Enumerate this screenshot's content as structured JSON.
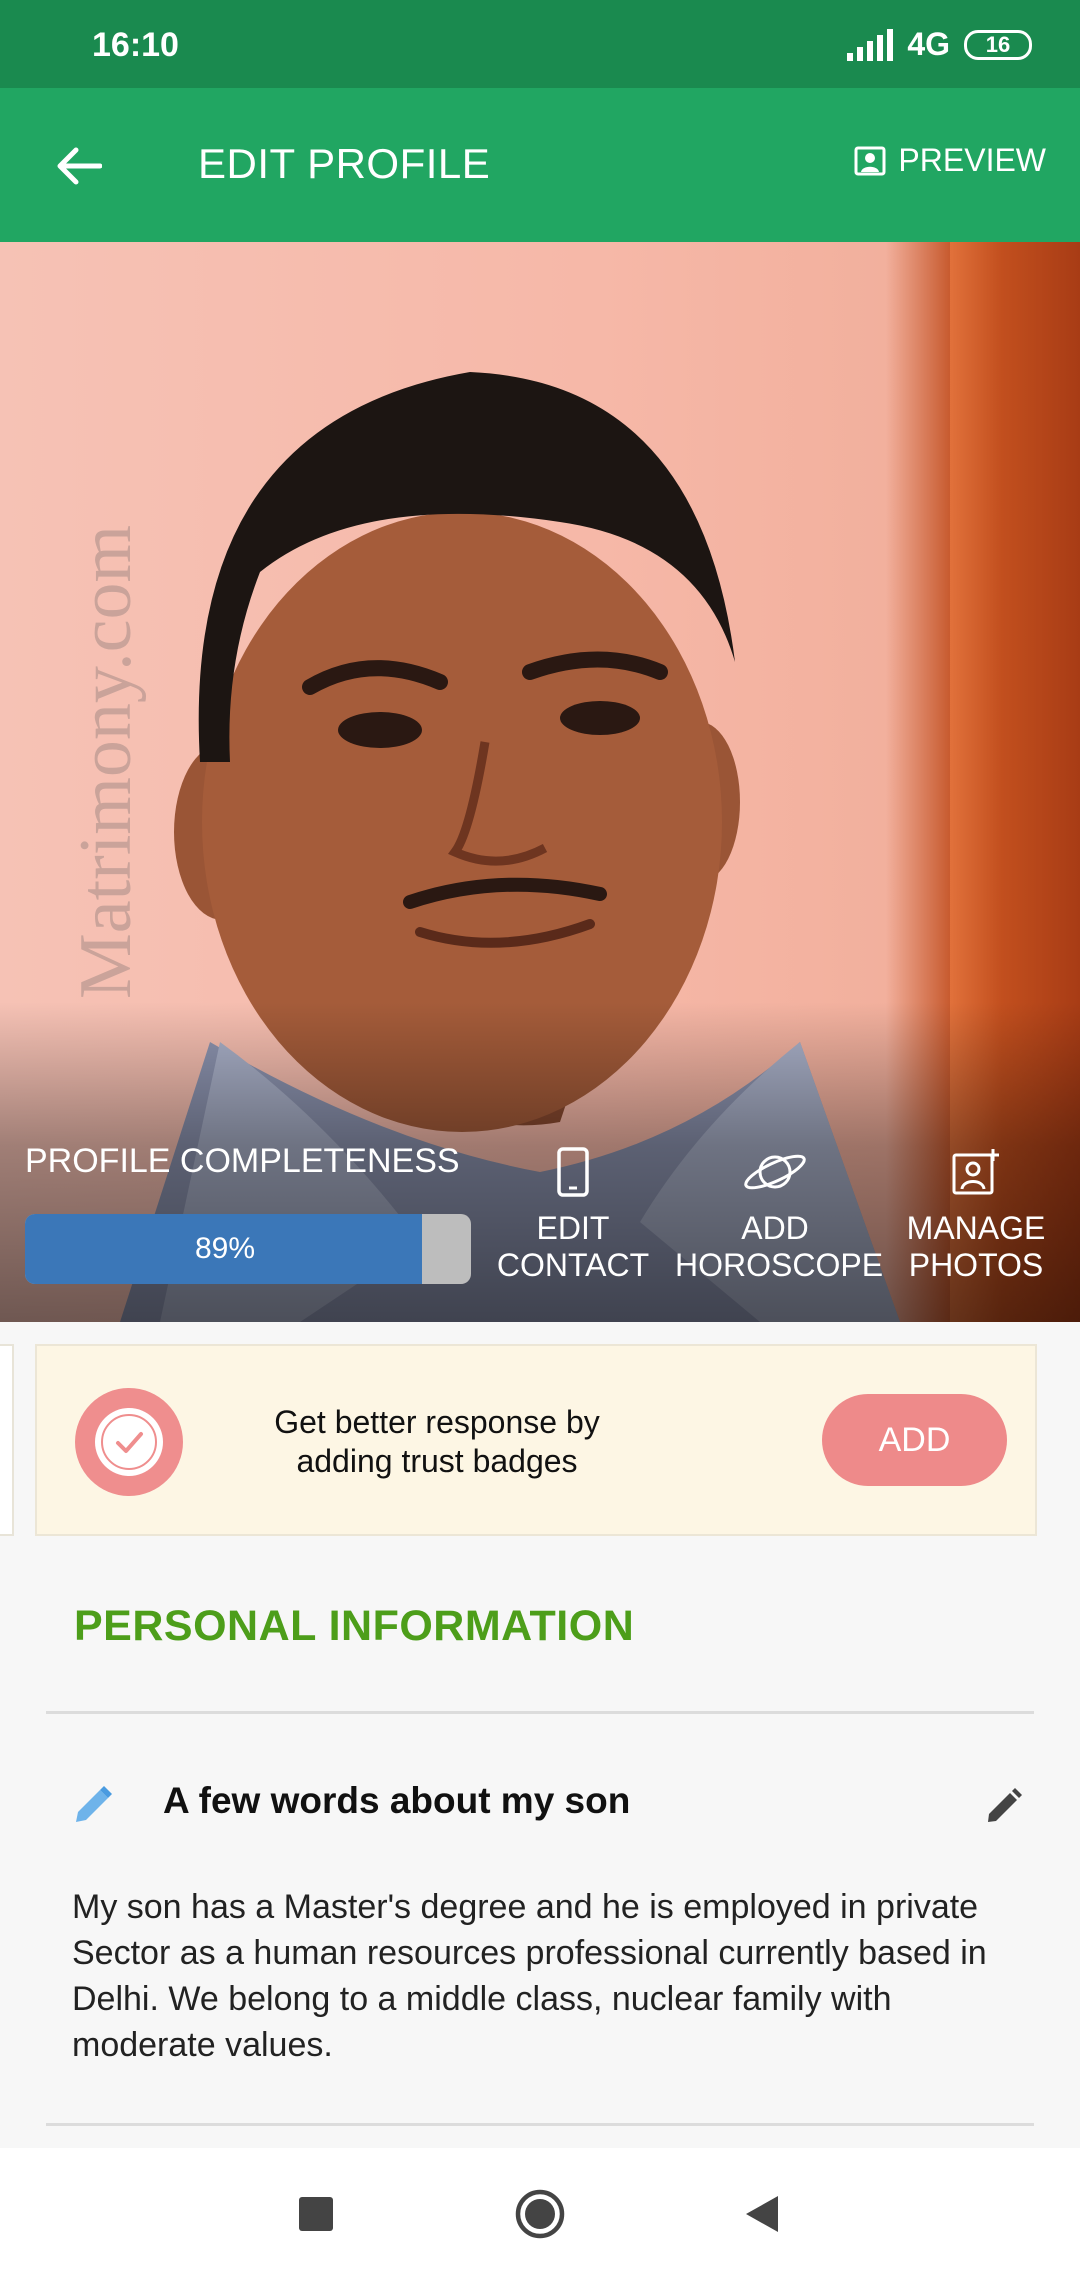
{
  "status_bar": {
    "time": "16:10",
    "network": "4G",
    "battery": "16"
  },
  "app_bar": {
    "title": "EDIT PROFILE",
    "preview_label": "PREVIEW"
  },
  "hero": {
    "watermark": "Matrimony.com",
    "completeness_label": "PROFILE COMPLETENESS",
    "completeness_value": 0.89,
    "completeness_text": "89%",
    "actions": [
      {
        "line1": "EDIT",
        "line2": "CONTACT",
        "icon": "phone-icon"
      },
      {
        "line1": "ADD",
        "line2": "HOROSCOPE",
        "icon": "planet-icon"
      },
      {
        "line1": "MANAGE",
        "line2": "PHOTOS",
        "icon": "add-photo-icon"
      }
    ]
  },
  "trust_card": {
    "text": "Get better response by adding trust badges",
    "button_label": "ADD"
  },
  "personal_info": {
    "section_title": "PERSONAL INFORMATION",
    "about_title": "A few words about my son",
    "about_text": "My son has a Master's degree and he is employed in private Sector as a human resources professional currently based in Delhi. We belong to a middle class, nuclear family with moderate values."
  },
  "colors": {
    "status_bar": "#1a8a4f",
    "app_bar": "#21a662",
    "progress_fill": "#3b77b8",
    "section_title": "#4d9e1a",
    "add_button": "#ee8a8a",
    "trust_card_bg": "#fdf6e4"
  }
}
